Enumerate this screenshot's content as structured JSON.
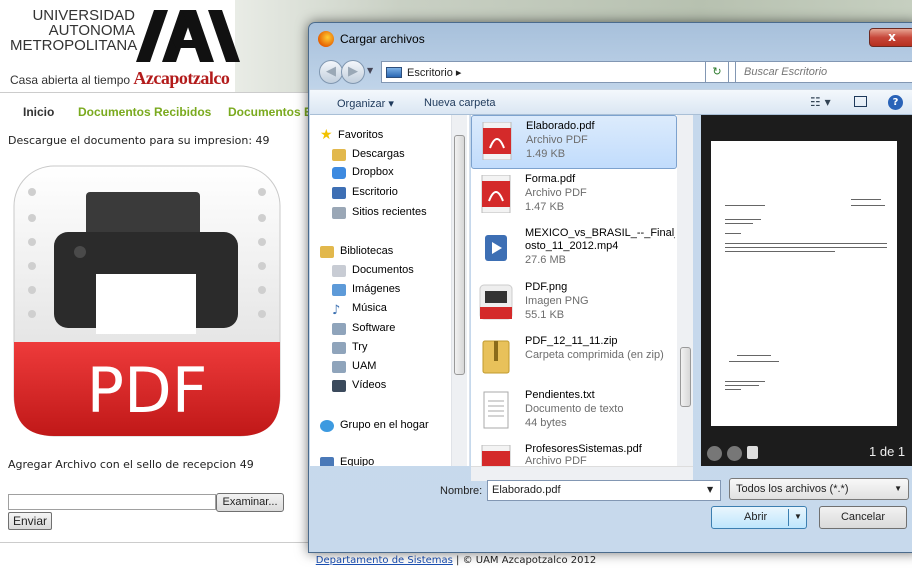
{
  "page": {
    "logo": {
      "line1": "UNIVERSIDAD",
      "line2": "AUTONOMA",
      "line3": "METROPOLITANA",
      "motto": "Casa abierta al tiempo",
      "campus": "Azcapotzalco"
    },
    "nav": {
      "inicio": "Inicio",
      "recibidos": "Documentos Recibidos",
      "elaborados": "Documentos Ela"
    },
    "download_text": "Descargue el documento para su impresion: 49",
    "pdf_icon_label": "PDF",
    "agregar_text": "Agregar Archivo con el sello de recepcion 49",
    "examinar_label": "Examinar...",
    "enviar_label": "Enviar",
    "footer": {
      "link": "Departamento de Sistemas",
      "rest": " | © UAM Azcapotzalco 2012"
    }
  },
  "dialog": {
    "title": "Cargar archivos",
    "close_label": "x",
    "address": "Escritorio",
    "address_sep": "▸",
    "search_placeholder": "Buscar Escritorio",
    "toolbar": {
      "organizar": "Organizar ▾",
      "nueva_carpeta": "Nueva carpeta"
    },
    "nav_pane": [
      {
        "label": "Favoritos",
        "icon": "star-icon",
        "color": "#f2c200"
      },
      {
        "label": "Descargas",
        "icon": "downloads-folder-icon",
        "color": "#e2b84c"
      },
      {
        "label": "Dropbox",
        "icon": "dropbox-icon",
        "color": "#3d8ae0"
      },
      {
        "label": "Escritorio",
        "icon": "desktop-icon",
        "color": "#3e6fb4"
      },
      {
        "label": "Sitios recientes",
        "icon": "recent-places-icon",
        "color": "#9aa7b6"
      },
      {
        "label": "Bibliotecas",
        "icon": "libraries-icon",
        "color": "#e2b84c"
      },
      {
        "label": "Documentos",
        "icon": "documents-icon",
        "color": "#c8ccd4"
      },
      {
        "label": "Imágenes",
        "icon": "pictures-icon",
        "color": "#5d9ad8"
      },
      {
        "label": "Música",
        "icon": "music-icon",
        "color": "#3a6fb0"
      },
      {
        "label": "Software",
        "icon": "library-icon",
        "color": "#8fa4bb"
      },
      {
        "label": "Try",
        "icon": "library-icon",
        "color": "#8fa4bb"
      },
      {
        "label": "UAM",
        "icon": "library-icon",
        "color": "#8fa4bb"
      },
      {
        "label": "Vídeos",
        "icon": "videos-icon",
        "color": "#3b4a5c"
      },
      {
        "label": "Grupo en el hogar",
        "icon": "homegroup-icon",
        "color": "#3d9ae0"
      },
      {
        "label": "Equipo",
        "icon": "computer-icon",
        "color": "#4a79b8"
      }
    ],
    "files": [
      {
        "name": "Elaborado.pdf",
        "type": "Archivo PDF",
        "size": "1.49 KB",
        "icon": "pdf-file-icon"
      },
      {
        "name": "Forma.pdf",
        "type": "Archivo PDF",
        "size": "1.47 KB",
        "icon": "pdf-file-icon"
      },
      {
        "name": "MEXICO_vs_BRASIL_--_Final_--_",
        "name2": "osto_11_2012.mp4",
        "size": "27.6 MB",
        "icon": "video-file-icon"
      },
      {
        "name": "PDF.png",
        "type": "Imagen PNG",
        "size": "55.1 KB",
        "icon": "png-file-icon"
      },
      {
        "name": "PDF_12_11_11.zip",
        "type": "Carpeta comprimida (en zip)",
        "icon": "zip-file-icon"
      },
      {
        "name": "Pendientes.txt",
        "type": "Documento de texto",
        "size": "44 bytes",
        "icon": "txt-file-icon"
      },
      {
        "name": "ProfesoresSistemas.pdf",
        "type": "Archivo PDF",
        "icon": "pdf-file-icon"
      }
    ],
    "preview": {
      "page_count": "1 de 1"
    },
    "nombre_label": "Nombre:",
    "nombre_value": "Elaborado.pdf",
    "filter_value": "Todos los archivos (*.*)",
    "abrir_label": "Abrir",
    "cancelar_label": "Cancelar"
  }
}
